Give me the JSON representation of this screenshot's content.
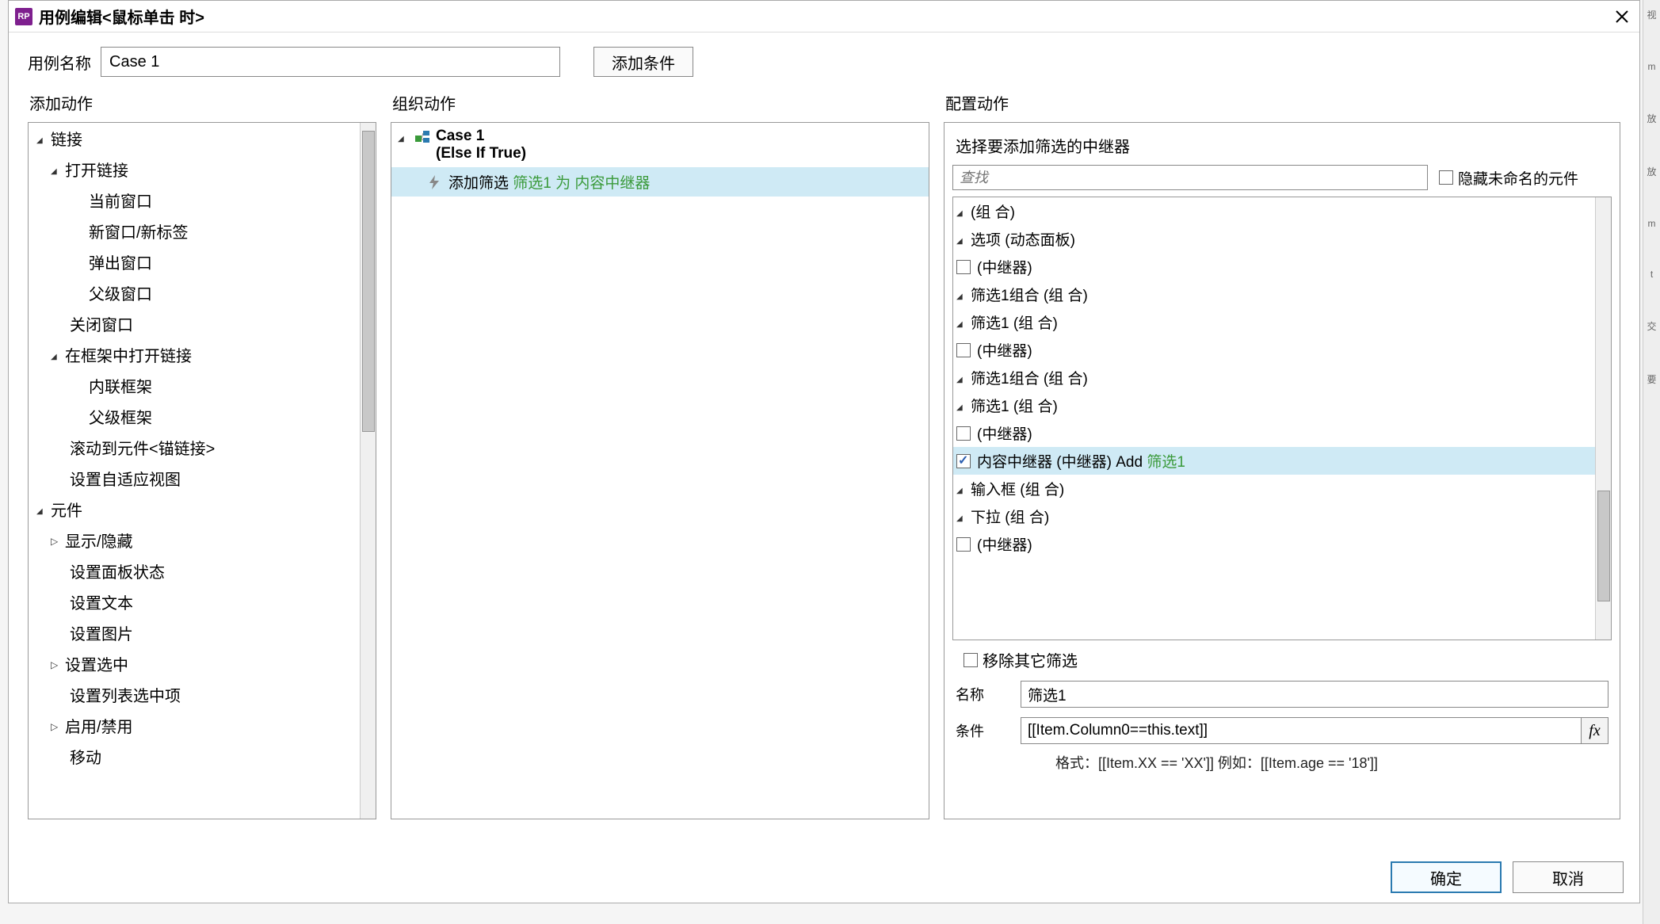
{
  "title": "用例编辑<鼠标单击 时>",
  "caseNameLabel": "用例名称",
  "caseNameValue": "Case 1",
  "addConditionBtn": "添加条件",
  "columns": {
    "addAction": "添加动作",
    "orgAction": "组织动作",
    "configAction": "配置动作"
  },
  "actionTree": {
    "links": "链接",
    "openLink": "打开链接",
    "currentWindow": "当前窗口",
    "newWindow": "新窗口/新标签",
    "popup": "弹出窗口",
    "parentWindow": "父级窗口",
    "closeWindow": "关闭窗口",
    "openInFrame": "在框架中打开链接",
    "inlineFrame": "内联框架",
    "parentFrame": "父级框架",
    "scrollToAnchor": "滚动到元件<锚链接>",
    "setAdaptive": "设置自适应视图",
    "widgets": "元件",
    "showHide": "显示/隐藏",
    "setPanelState": "设置面板状态",
    "setText": "设置文本",
    "setImage": "设置图片",
    "setSelected": "设置选中",
    "setListSelected": "设置列表选中项",
    "enableDisable": "启用/禁用",
    "move": "移动"
  },
  "caseTree": {
    "caseName": "Case 1",
    "condition": "(Else If True)",
    "actionPrefix": "添加筛选 ",
    "actionGreen": "筛选1 为 内容中继器"
  },
  "config": {
    "selectRepeaterLabel": "选择要添加筛选的中继器",
    "searchPlaceholder": "查找",
    "hideUnnamed": "隐藏未命名的元件",
    "tree": {
      "group": "(组 合)",
      "optionsDyn": "选项 (动态面板)",
      "repeater": "(中继器)",
      "filter1Group": "筛选1组合 (组 合)",
      "filter1": "筛选1 (组 合)",
      "contentRepeater": "内容中继器 (中继器) Add ",
      "contentRepeaterGreen": "筛选1",
      "inputGroup": "输入框 (组 合)",
      "dropdown": "下拉 (组 合)"
    },
    "removeOther": "移除其它筛选",
    "nameLabel": "名称",
    "nameValue": "筛选1",
    "condLabel": "条件",
    "condValue": "[[Item.Column0==this.text]]",
    "hint": "格式：[[Item.XX == 'XX']] 例如：[[Item.age == '18']]"
  },
  "footer": {
    "ok": "确定",
    "cancel": "取消"
  }
}
